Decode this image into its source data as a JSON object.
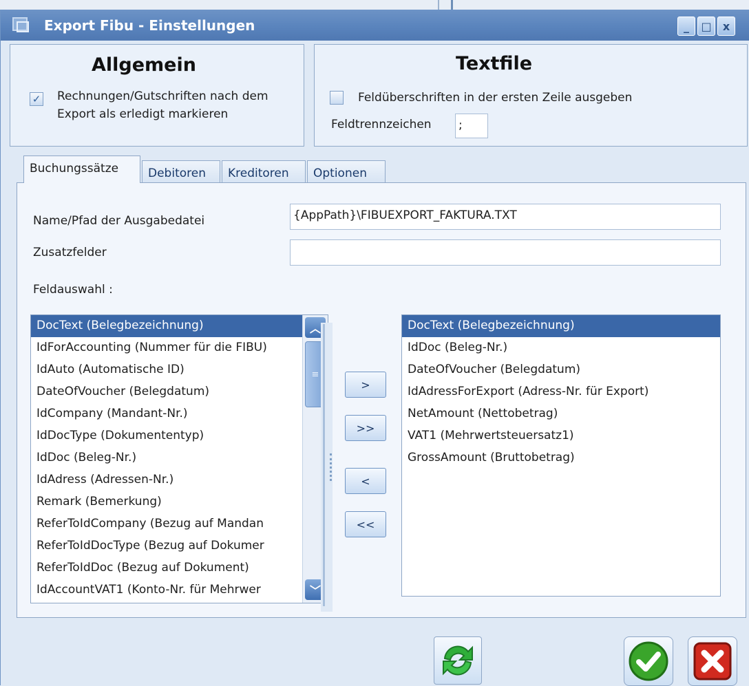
{
  "window": {
    "title": "Export Fibu - Einstellungen",
    "controls": {
      "minimize": "_",
      "maximize": "□",
      "close": "x"
    }
  },
  "allgemein": {
    "header": "Allgemein",
    "mark_done": {
      "checked": true,
      "line1": "Rechnungen/Gutschriften nach dem",
      "line2": "Export als erledigt markieren"
    }
  },
  "textfile": {
    "header": "Textfile",
    "headers_first_line": {
      "checked": false,
      "label": "Feldüberschriften in der ersten Zeile ausgeben"
    },
    "separator_label": "Feldtrennzeichen",
    "separator_value": ";"
  },
  "tabs": [
    {
      "label": "Buchungssätze",
      "active": true
    },
    {
      "label": "Debitoren",
      "active": false
    },
    {
      "label": "Kreditoren",
      "active": false
    },
    {
      "label": "Optionen",
      "active": false
    }
  ],
  "form": {
    "output_label": "Name/Pfad der Ausgabedatei",
    "output_value": "{AppPath}\\FIBUEXPORT_FAKTURA.TXT",
    "extra_label": "Zusatzfelder",
    "extra_value": "",
    "selection_label": "Feldauswahl :"
  },
  "available_fields": [
    "DocText (Belegbezeichnung)",
    "IdForAccounting (Nummer für die FIBU)",
    "IdAuto (Automatische ID)",
    "DateOfVoucher (Belegdatum)",
    "IdCompany (Mandant-Nr.)",
    "IdDocType (Dokumententyp)",
    "IdDoc (Beleg-Nr.)",
    "IdAdress (Adressen-Nr.)",
    "Remark (Bemerkung)",
    "ReferToIdCompany (Bezug auf Mandan",
    "ReferToIdDocType (Bezug auf Dokumer",
    "ReferToIdDoc (Bezug auf Dokument)",
    "IdAccountVAT1 (Konto-Nr. für Mehrwer"
  ],
  "selected_fields": [
    "DocText (Belegbezeichnung)",
    "IdDoc (Beleg-Nr.)",
    "DateOfVoucher (Belegdatum)",
    "IdAdressForExport (Adress-Nr. für Export)",
    "NetAmount (Nettobetrag)",
    "VAT1 (Mehrwertsteuersatz1)",
    "GrossAmount (Bruttobetrag)"
  ],
  "move_buttons": {
    "add": ">",
    "add_all": ">>",
    "remove": "<",
    "remove_all": "<<"
  },
  "icons": {
    "refresh": "refresh-icon",
    "ok": "check-icon",
    "cancel": "close-icon"
  },
  "colors": {
    "selection": "#3a67a8",
    "titlebar": "#5a84bd",
    "ok_green": "#3aa52b",
    "cancel_red": "#d12a1f"
  }
}
